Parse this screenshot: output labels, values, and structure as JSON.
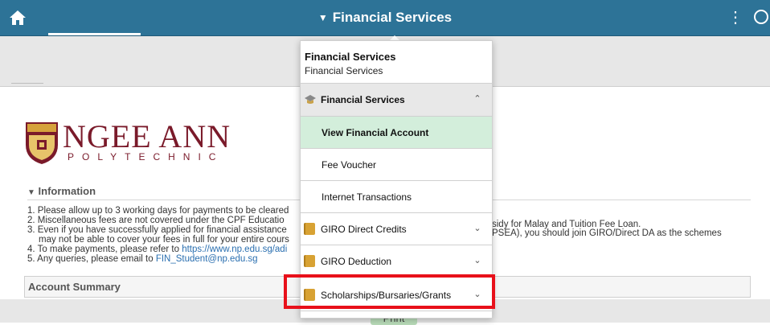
{
  "header": {
    "title": "Financial Services",
    "caret": "▼",
    "kebab": "⋮"
  },
  "logo": {
    "name": "NGEE ANN",
    "subtitle": "POLYTECHNIC",
    "crest_text": "NGEE ANN"
  },
  "info": {
    "header": "Information",
    "lines": [
      "1. Please allow up to 3 working days for payments to be cleared",
      "2. Miscellaneous fees are not covered under the CPF Educatio",
      "3. Even if you have successfully applied for financial assistance",
      "    may not be able to cover your fees in full for your entire cours",
      "4. To make payments, please refer to ",
      "5. Any queries, please email to "
    ],
    "link_payments": "https://www.np.edu.sg/adi",
    "link_email": "FIN_Student@np.edu.sg",
    "right_line1": "sidy for Malay and Tuition Fee Loan.",
    "right_line2": "PSEA), you should join GIRO/Direct DA as the schemes"
  },
  "account_summary": "Account Summary",
  "print_label": "Print",
  "menu": {
    "header_title": "Financial Services",
    "header_subtitle": "Financial Services",
    "section_label": "Financial Services",
    "section_chevron": "⌃",
    "items": [
      {
        "label": "View Financial Account",
        "selected": true
      },
      {
        "label": "Fee Voucher"
      },
      {
        "label": "Internet Transactions"
      }
    ],
    "folders": [
      {
        "label": "GIRO Direct Credits",
        "chevron": "⌄"
      },
      {
        "label": "GIRO Deduction",
        "chevron": "⌄"
      },
      {
        "label": "Scholarships/Bursaries/Grants",
        "chevron": "⌄"
      }
    ]
  },
  "colors": {
    "header_bg": "#2d7397",
    "selected_bg": "#d3eedb",
    "highlight": "#e8101a",
    "logo": "#7a1a2a"
  }
}
